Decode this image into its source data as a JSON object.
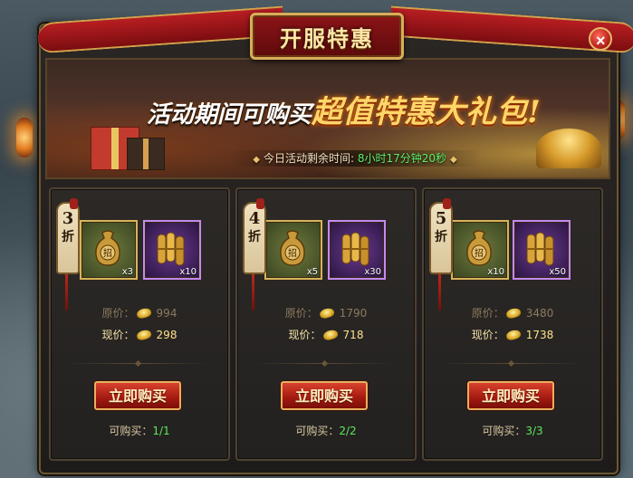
{
  "dialog": {
    "title": "开服特惠",
    "close_symbol": "×"
  },
  "banner": {
    "heading_prefix": "活动期间可购买",
    "heading_highlight": "超值特惠大礼包!",
    "timer_label": "今日活动剩余时间:",
    "timer_value": "8小时17分钟20秒"
  },
  "labels": {
    "original_price": "原价：",
    "current_price": "现价：",
    "buy_button": "立即购买",
    "can_buy": "可购买："
  },
  "offers": [
    {
      "discount_number": "3",
      "discount_unit": "折",
      "items": [
        {
          "icon": "token-pouch-icon",
          "quantity": "x3"
        },
        {
          "icon": "scroll-bundle-icon",
          "quantity": "x10"
        }
      ],
      "original_price": "994",
      "current_price": "298",
      "purchase_limit": "1/1"
    },
    {
      "discount_number": "4",
      "discount_unit": "折",
      "items": [
        {
          "icon": "token-pouch-icon",
          "quantity": "x5"
        },
        {
          "icon": "scroll-bundle-icon",
          "quantity": "x30"
        }
      ],
      "original_price": "1790",
      "current_price": "718",
      "purchase_limit": "2/2"
    },
    {
      "discount_number": "5",
      "discount_unit": "折",
      "items": [
        {
          "icon": "token-pouch-icon",
          "quantity": "x10"
        },
        {
          "icon": "scroll-bundle-icon",
          "quantity": "x50"
        }
      ],
      "original_price": "3480",
      "current_price": "1738",
      "purchase_limit": "3/3"
    }
  ],
  "colors": {
    "title_ribbon": "#b81e22",
    "gold_trim": "#d8ad5a",
    "limit_green": "#5ce85a",
    "timer_green": "#5cf06a"
  }
}
